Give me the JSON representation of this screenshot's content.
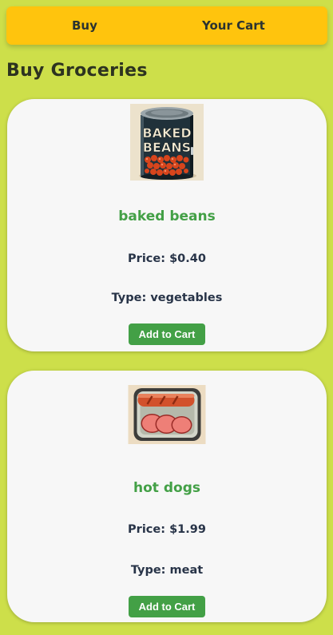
{
  "nav": {
    "buy_label": "Buy",
    "cart_label": "Your Cart"
  },
  "page": {
    "title": "Buy Groceries"
  },
  "products": [
    {
      "name": "baked beans",
      "price": "Price: $0.40",
      "type": "Type: vegetables",
      "button_label": "Add to Cart",
      "image_text_line1": "BAKED",
      "image_text_line2": "BEANS"
    },
    {
      "name": "hot dogs",
      "price": "Price: $1.99",
      "type": "Type: meat",
      "button_label": "Add to Cart"
    }
  ],
  "colors": {
    "background": "#cddf4a",
    "nav_bar": "#ffc40d",
    "accent_green": "#43a046",
    "card": "#f7f7f7"
  }
}
